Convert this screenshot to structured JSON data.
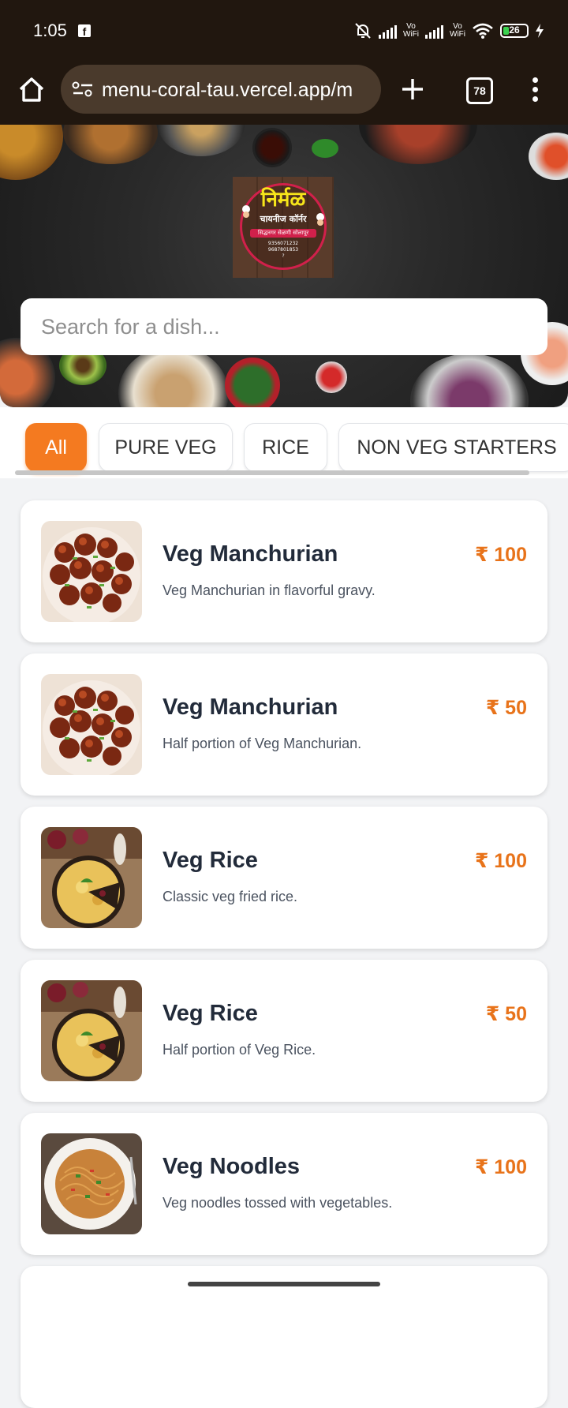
{
  "status_bar": {
    "time": "1:05",
    "battery_level": "26",
    "icons": [
      "facebook-icon",
      "mute-icon",
      "signal-icon",
      "vowifi-icon",
      "wifi-icon",
      "battery-icon",
      "charging-icon"
    ],
    "vowifi_label": "Vo\nWiFi"
  },
  "browser": {
    "url": "menu-coral-tau.vercel.app/m",
    "tab_count": "78",
    "icons": [
      "home-icon",
      "site-settings-icon",
      "plus-icon",
      "tabs-icon",
      "more-vert-icon"
    ]
  },
  "hero": {
    "logo": {
      "title": "निर्मळ",
      "subtitle": "चायनीज कॉर्नर",
      "banner": "सिद्धनगर सेळणी सोलापूर",
      "phone_1": "9356071232",
      "phone_2": "9687801853",
      "phone_3": "?"
    },
    "search_placeholder": "Search for a dish..."
  },
  "categories": [
    {
      "label": "All",
      "active": true
    },
    {
      "label": "PURE VEG",
      "active": false
    },
    {
      "label": "RICE",
      "active": false
    },
    {
      "label": "NON VEG STARTERS",
      "active": false
    }
  ],
  "menu_items": [
    {
      "name": "Veg Manchurian",
      "description": "Veg Manchurian in flavorful gravy.",
      "price": "₹ 100",
      "image": "manchurian"
    },
    {
      "name": "Veg Manchurian",
      "description": "Half portion of Veg Manchurian.",
      "price": "₹ 50",
      "image": "manchurian"
    },
    {
      "name": "Veg Rice",
      "description": "Classic veg fried rice.",
      "price": "₹ 100",
      "image": "rice"
    },
    {
      "name": "Veg Rice",
      "description": "Half portion of Veg Rice.",
      "price": "₹ 50",
      "image": "rice"
    },
    {
      "name": "Veg Noodles",
      "description": "Veg noodles tossed with vegetables.",
      "price": "₹ 100",
      "image": "noodles"
    }
  ],
  "colors": {
    "accent": "#f47a20",
    "price": "#e8731a",
    "chrome": "#21170f",
    "urlbar": "#4a3a2c",
    "page_bg": "#f2f3f5"
  }
}
